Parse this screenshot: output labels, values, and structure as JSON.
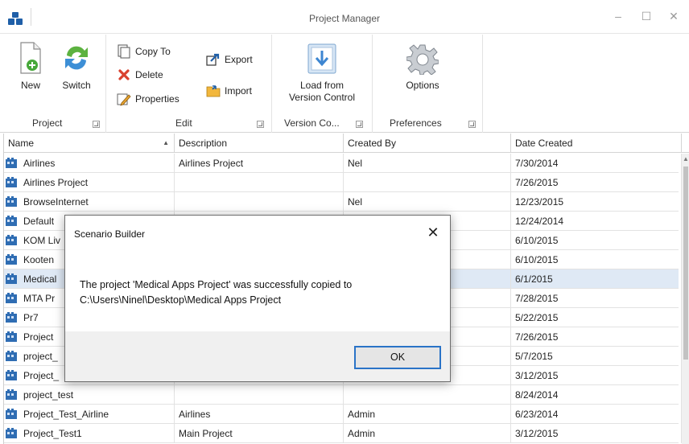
{
  "window": {
    "title": "Project Manager",
    "minimize_glyph": "–",
    "maximize_glyph": "☐",
    "close_glyph": "✕"
  },
  "ribbon": {
    "groups": {
      "project": {
        "label": "Project",
        "new_label": "New",
        "switch_label": "Switch"
      },
      "edit": {
        "label": "Edit",
        "copy_to": "Copy To",
        "delete": "Delete",
        "properties": "Properties",
        "export": "Export",
        "import": "Import"
      },
      "version_control": {
        "label": "Version Co...",
        "load_line1": "Load from",
        "load_line2": "Version Control"
      },
      "preferences": {
        "label": "Preferences",
        "options": "Options"
      }
    }
  },
  "grid": {
    "columns": [
      "Name",
      "Description",
      "Created By",
      "Date Created"
    ],
    "rows": [
      {
        "name": "Airlines",
        "description": "Airlines Project",
        "created_by": "Nel",
        "date": "7/30/2014"
      },
      {
        "name": "Airlines Project",
        "description": "",
        "created_by": "",
        "date": "7/26/2015"
      },
      {
        "name": "BrowseInternet",
        "description": "",
        "created_by": "Nel",
        "date": "12/23/2015"
      },
      {
        "name": "Default",
        "description": "",
        "created_by": "",
        "date": "12/24/2014"
      },
      {
        "name": "KOM Liv",
        "description": "",
        "created_by": "",
        "date": "6/10/2015"
      },
      {
        "name": "Kooten",
        "description": "",
        "created_by": "",
        "date": "6/10/2015"
      },
      {
        "name": "Medical",
        "description": "",
        "created_by": "",
        "date": "6/1/2015"
      },
      {
        "name": "MTA Pr",
        "description": "",
        "created_by": "",
        "date": "7/28/2015"
      },
      {
        "name": "Pr7",
        "description": "",
        "created_by": "",
        "date": "5/22/2015"
      },
      {
        "name": "Project",
        "description": "",
        "created_by": "",
        "date": "7/26/2015"
      },
      {
        "name": "project_",
        "description": "",
        "created_by": "",
        "date": "5/7/2015"
      },
      {
        "name": "Project_",
        "description": "",
        "created_by": "",
        "date": "3/12/2015"
      },
      {
        "name": "project_test",
        "description": "",
        "created_by": "",
        "date": "8/24/2014"
      },
      {
        "name": "Project_Test_Airline",
        "description": "Airlines",
        "created_by": "Admin",
        "date": "6/23/2014"
      },
      {
        "name": "Project_Test1",
        "description": "Main Project",
        "created_by": "Admin",
        "date": "3/12/2015"
      }
    ]
  },
  "dialog": {
    "title": "Scenario Builder",
    "close_glyph": "✕",
    "message_line1": "The project 'Medical Apps Project' was successfully copied to",
    "message_line2": "C:\\Users\\Ninel\\Desktop\\Medical Apps Project",
    "ok_label": "OK"
  },
  "colors": {
    "accent": "#2a73c7",
    "selected_row": "#dfe9f5",
    "icon_blue": "#1f5fa8"
  }
}
